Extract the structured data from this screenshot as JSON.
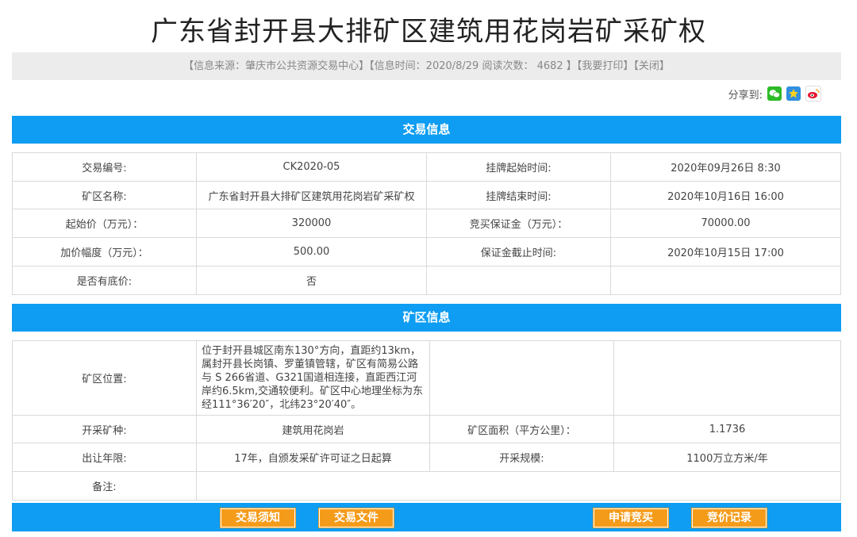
{
  "title": "广东省封开县大排矿区建筑用花岗岩矿采矿权",
  "infobar": {
    "source": "【信息来源：肇庆市公共资源交易中心】",
    "time_reads": "【信息时间：2020/8/29 阅读次数： 4682 】",
    "print": "【我要打印】",
    "close": "【关闭】"
  },
  "share": {
    "label": "分享到:",
    "icons": [
      "wechat-icon",
      "qzone-icon",
      "weibo-icon"
    ]
  },
  "section1": {
    "title": "交易信息",
    "rows": [
      [
        "交易编号:",
        "CK2020-05",
        "挂牌起始时间:",
        "2020年09月26日 8:30"
      ],
      [
        "矿区名称:",
        "广东省封开县大排矿区建筑用花岗岩矿采矿权",
        "挂牌结束时间:",
        "2020年10月16日 16:00"
      ],
      [
        "起始价（万元）：",
        "320000",
        "竞买保证金（万元）：",
        "70000.00"
      ],
      [
        "加价幅度（万元）：",
        "500.00",
        "保证金截止时间:",
        "2020年10月15日 17:00"
      ],
      [
        "是否有底价:",
        "否",
        "",
        ""
      ]
    ]
  },
  "section2": {
    "title": "矿区信息",
    "location_label": "矿区位置:",
    "location_text": "位于封开县城区南东130°方向，直距约13km，属封开县长岗镇、罗董镇管辖，矿区有简易公路与 S 266省道、G321国道相连接，直距西江河岸约6.5km,交通较便利。矿区中心地理坐标为东经111°36′20″，北纬23°20′40″。",
    "rows": [
      [
        "开采矿种:",
        "建筑用花岗岩",
        "矿区面积（平方公里）：",
        "1.1736"
      ],
      [
        "出让年限:",
        "17年，自颁发采矿许可证之日起算",
        "开采规模:",
        "1100万立方米/年"
      ]
    ],
    "remark_label": "备注:",
    "remark_value": ""
  },
  "buttons": {
    "notice": "交易须知",
    "files": "交易文件",
    "apply": "申请竞买",
    "records": "竞价记录"
  },
  "colors": {
    "accent": "#0e9df2",
    "button": "#f59b1a"
  }
}
